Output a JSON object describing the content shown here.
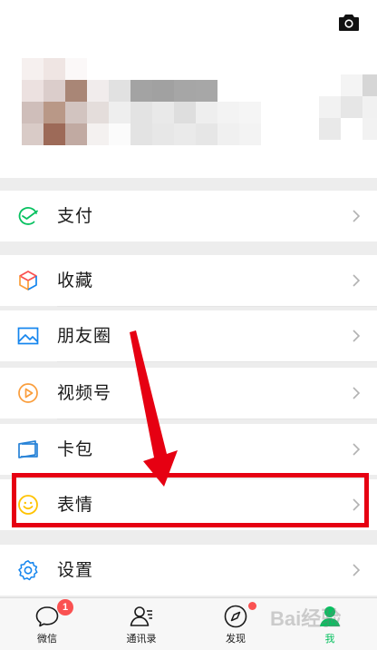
{
  "header": {
    "camera_icon": "camera-icon"
  },
  "menu": {
    "items": [
      {
        "label": "支付",
        "icon": "pay-icon",
        "color": "#07c160"
      },
      {
        "label": "收藏",
        "icon": "favorites-cube-icon",
        "color": "#fa9d3b"
      },
      {
        "label": "朋友圈",
        "icon": "moments-image-icon",
        "color": "#1485ee"
      },
      {
        "label": "视频号",
        "icon": "channels-play-icon",
        "color": "#fa9d3b"
      },
      {
        "label": "卡包",
        "icon": "card-wallet-icon",
        "color": "#2782d7"
      },
      {
        "label": "表情",
        "icon": "sticker-smile-icon",
        "color": "#ffc300"
      },
      {
        "label": "设置",
        "icon": "settings-gear-icon",
        "color": "#1485ee"
      }
    ]
  },
  "tab_bar": {
    "tabs": [
      {
        "label": "微信",
        "icon": "chat-bubble-icon",
        "badge": "1"
      },
      {
        "label": "通讯录",
        "icon": "contacts-icon"
      },
      {
        "label": "发现",
        "icon": "compass-icon",
        "dot": true
      },
      {
        "label": "我",
        "icon": "me-person-icon",
        "active": true
      }
    ],
    "active_color": "#07c160"
  },
  "annotation": {
    "highlight_color": "#e60012"
  },
  "watermark": "Bai经验"
}
